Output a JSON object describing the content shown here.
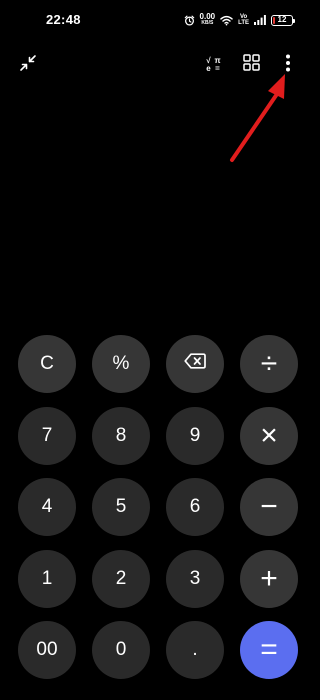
{
  "status_bar": {
    "time": "22:48",
    "net_speed_value": "0.00",
    "net_speed_unit": "KB/S",
    "volte_top": "Vo",
    "volte_bottom": "LTE",
    "battery_level": "12",
    "battery_color": "#e53935",
    "icons": [
      "alarm-icon",
      "wifi-icon",
      "signal-icon",
      "battery-icon"
    ]
  },
  "toolbar": {
    "collapse_icon": "collapse-arrows-icon",
    "scientific_glyphs": {
      "root": "√",
      "pi": "π",
      "e": "e",
      "equals": "="
    },
    "converter_icon": "grid-icon",
    "more_icon": "more-vertical-icon"
  },
  "annotation": {
    "type": "arrow",
    "color": "#e11d1d",
    "points_to": "more-options-button"
  },
  "keypad": {
    "rows": [
      [
        {
          "label": "C",
          "name": "clear-button",
          "style": "fn"
        },
        {
          "label": "%",
          "name": "percent-button",
          "style": "fn"
        },
        {
          "label": "",
          "name": "backspace-button",
          "style": "fn",
          "icon": "backspace-icon"
        },
        {
          "label": "÷",
          "name": "divide-button",
          "style": "fn"
        }
      ],
      [
        {
          "label": "7",
          "name": "digit-7-button",
          "style": "num"
        },
        {
          "label": "8",
          "name": "digit-8-button",
          "style": "num"
        },
        {
          "label": "9",
          "name": "digit-9-button",
          "style": "num"
        },
        {
          "label": "×",
          "name": "multiply-button",
          "style": "fn"
        }
      ],
      [
        {
          "label": "4",
          "name": "digit-4-button",
          "style": "num"
        },
        {
          "label": "5",
          "name": "digit-5-button",
          "style": "num"
        },
        {
          "label": "6",
          "name": "digit-6-button",
          "style": "num"
        },
        {
          "label": "−",
          "name": "subtract-button",
          "style": "fn"
        }
      ],
      [
        {
          "label": "1",
          "name": "digit-1-button",
          "style": "num"
        },
        {
          "label": "2",
          "name": "digit-2-button",
          "style": "num"
        },
        {
          "label": "3",
          "name": "digit-3-button",
          "style": "num"
        },
        {
          "label": "+",
          "name": "add-button",
          "style": "fn"
        }
      ],
      [
        {
          "label": "00",
          "name": "double-zero-button",
          "style": "num"
        },
        {
          "label": "0",
          "name": "digit-0-button",
          "style": "num"
        },
        {
          "label": ".",
          "name": "decimal-point-button",
          "style": "num"
        },
        {
          "label": "=",
          "name": "equals-button",
          "style": "equals"
        }
      ]
    ],
    "colors": {
      "number_key": "#2a2a2a",
      "function_key": "#363636",
      "equals_key": "#5b6ef0"
    }
  }
}
